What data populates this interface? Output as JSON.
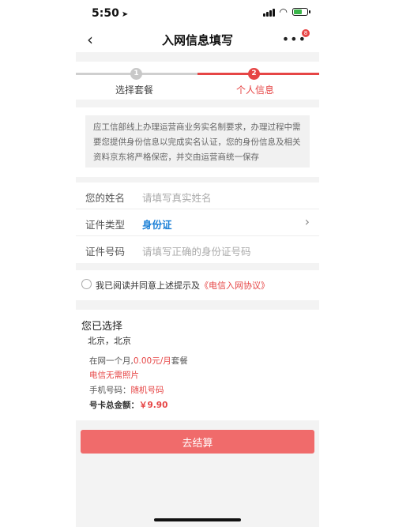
{
  "status": {
    "time": "5:50",
    "arrow_icon": "location-arrow-icon"
  },
  "nav": {
    "title": "入网信息填写",
    "back": "‹",
    "more": "•••",
    "badge": "8"
  },
  "steps": {
    "step1": {
      "number": "1",
      "label": "选择套餐"
    },
    "step2": {
      "number": "2",
      "label": "个人信息"
    }
  },
  "notice": "应工信部线上办理运营商业务实名制要求，办理过程中需要您提供身份信息以完成实名认证，您的身份信息及相关资料京东将严格保密，并交由运营商统一保存",
  "form": {
    "name": {
      "label": "您的姓名",
      "placeholder": "请填写真实姓名"
    },
    "id_type": {
      "label": "证件类型",
      "value": "身份证"
    },
    "id_number": {
      "label": "证件号码",
      "placeholder": "请填写正确的身份证号码"
    }
  },
  "agreement": {
    "text": "我已阅读并同意上述提示及",
    "link": "《电信入网协议》"
  },
  "summary": {
    "title": "您已选择",
    "city": "北京，北京",
    "plan_prefix": "在网一个月,",
    "plan_price": "0.00元/月",
    "plan_suffix": "套餐",
    "photo": "电信无需照片",
    "phone_label": "手机号码：",
    "phone_value": "随机号码",
    "total_label": "号卡总金额：",
    "total_value": "￥9.90"
  },
  "button": {
    "pay": "去结算"
  },
  "colors": {
    "accent": "#e64545",
    "button": "#f06b6b",
    "link_blue": "#1a7fd6"
  }
}
